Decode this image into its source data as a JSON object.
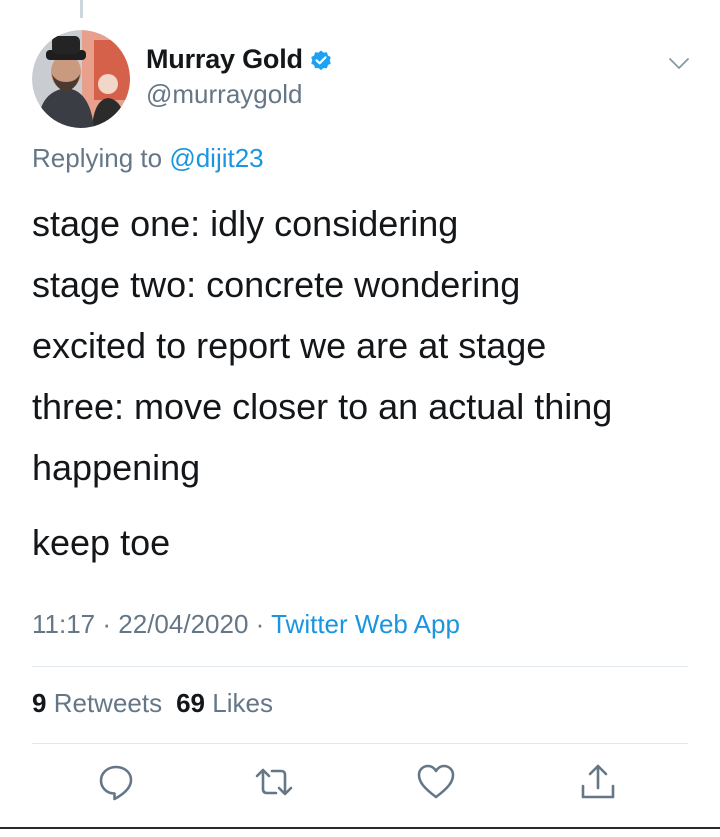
{
  "author": {
    "display_name": "Murray Gold",
    "handle": "@murraygold",
    "verified": true,
    "avatar_icon": "profile-photo"
  },
  "reply": {
    "prefix": "Replying to",
    "mention": "@dijit23"
  },
  "tweet": {
    "lines": [
      "stage one: idly considering",
      "stage two: concrete wondering",
      "excited to report we are at stage",
      "three: move closer to an actual thing",
      "happening"
    ],
    "closing": "keep toe"
  },
  "meta": {
    "time": "11:17",
    "separator": "·",
    "date": "22/04/2020",
    "source": "Twitter Web App"
  },
  "stats": {
    "retweets_count": "9",
    "retweets_label": "Retweets",
    "likes_count": "69",
    "likes_label": "Likes"
  },
  "icons": {
    "more": "chevron-down-icon",
    "reply": "reply-icon",
    "retweet": "retweet-icon",
    "like": "heart-icon",
    "share": "share-icon",
    "verified": "verified-badge-icon"
  },
  "colors": {
    "link": "#1b95e0",
    "secondary_text": "#657786",
    "primary_text": "#14171a",
    "divider": "#e1e8ed",
    "verified": "#1da1f2"
  }
}
